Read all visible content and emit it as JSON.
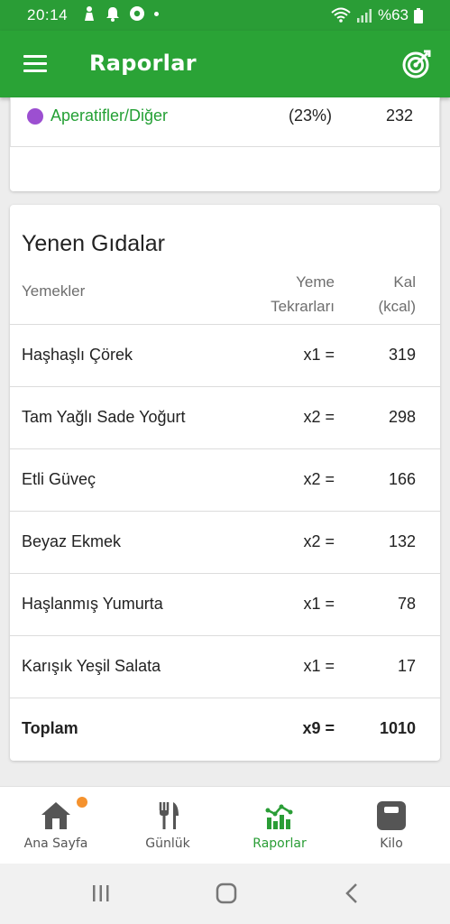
{
  "status_bar": {
    "time": "20:14",
    "battery": "%63"
  },
  "app_bar": {
    "title": "Raporlar"
  },
  "category_row": {
    "label": "Aperatifler/Diğer",
    "percent": "(23%)",
    "value": "232",
    "color": "#9c4fd1"
  },
  "foods_card": {
    "title": "Yenen Gıdalar",
    "columns": {
      "food": "Yemekler",
      "repeat_line1": "Yeme",
      "repeat_line2": "Tekrarları",
      "cal_line1": "Kal",
      "cal_line2": "(kcal)"
    },
    "rows": [
      {
        "name": "Haşhaşlı Çörek",
        "count": "x1 =",
        "kcal": "319"
      },
      {
        "name": "Tam Yağlı Sade Yoğurt",
        "count": "x2 =",
        "kcal": "298"
      },
      {
        "name": "Etli Güveç",
        "count": "x2 =",
        "kcal": "166"
      },
      {
        "name": "Beyaz Ekmek",
        "count": "x2 =",
        "kcal": "132"
      },
      {
        "name": "Haşlanmış Yumurta",
        "count": "x1 =",
        "kcal": "78"
      },
      {
        "name": "Karışık Yeşil Salata",
        "count": "x1 =",
        "kcal": "17"
      }
    ],
    "total": {
      "name": "Toplam",
      "count": "x9 =",
      "kcal": "1010"
    }
  },
  "bottom_nav": {
    "items": [
      {
        "label": "Ana Sayfa",
        "icon": "home-icon"
      },
      {
        "label": "Günlük",
        "icon": "fork-knife-icon"
      },
      {
        "label": "Raporlar",
        "icon": "chart-icon"
      },
      {
        "label": "Kilo",
        "icon": "scale-icon"
      }
    ],
    "active": "Raporlar"
  },
  "colors": {
    "primary": "#2aa336",
    "accent": "#f5922e"
  }
}
